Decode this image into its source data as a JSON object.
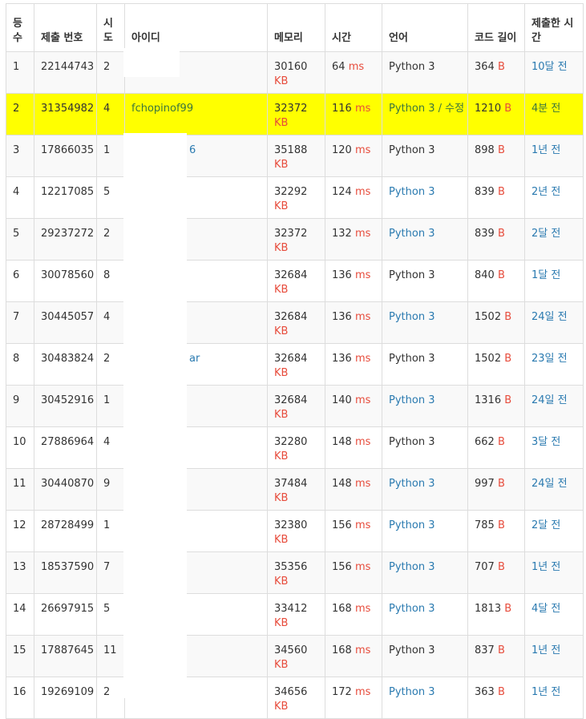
{
  "headers": {
    "rank": "등\n수",
    "submission": "제출 번호",
    "tries": "시\n도",
    "userid": "아이디",
    "memory": "메모리",
    "time": "시간",
    "language": "언어",
    "code_length": "코드 길이",
    "submitted_at": "제출한 시\n간"
  },
  "units": {
    "memory": "KB",
    "time": "ms",
    "length": "B"
  },
  "rows": [
    {
      "rank": "1",
      "sub": "22144743",
      "tries": "2",
      "user": "",
      "mem": "30160",
      "time": "64",
      "lang": "Python 3",
      "lang_link": false,
      "len": "364",
      "ago": "10달 전"
    },
    {
      "rank": "2",
      "sub": "31354982",
      "tries": "4",
      "user": "fchopinof99",
      "mem": "32372",
      "time": "116",
      "lang": "Python 3 / 수정",
      "lang_link": false,
      "len": "1210",
      "ago": "4분 전"
    },
    {
      "rank": "3",
      "sub": "17866035",
      "tries": "1",
      "user": "6",
      "mem": "35188",
      "time": "120",
      "lang": "Python 3",
      "lang_link": false,
      "len": "898",
      "ago": "1년 전"
    },
    {
      "rank": "4",
      "sub": "12217085",
      "tries": "5",
      "user": "",
      "mem": "32292",
      "time": "124",
      "lang": "Python 3",
      "lang_link": true,
      "len": "839",
      "ago": "2년 전"
    },
    {
      "rank": "5",
      "sub": "29237272",
      "tries": "2",
      "user": "",
      "mem": "32372",
      "time": "132",
      "lang": "Python 3",
      "lang_link": true,
      "len": "839",
      "ago": "2달 전"
    },
    {
      "rank": "6",
      "sub": "30078560",
      "tries": "8",
      "user": "",
      "mem": "32684",
      "time": "136",
      "lang": "Python 3",
      "lang_link": false,
      "len": "840",
      "ago": "1달 전"
    },
    {
      "rank": "7",
      "sub": "30445057",
      "tries": "4",
      "user": "",
      "mem": "32684",
      "time": "136",
      "lang": "Python 3",
      "lang_link": true,
      "len": "1502",
      "ago": "24일 전"
    },
    {
      "rank": "8",
      "sub": "30483824",
      "tries": "2",
      "user": "ar",
      "mem": "32684",
      "time": "136",
      "lang": "Python 3",
      "lang_link": false,
      "len": "1502",
      "ago": "23일 전"
    },
    {
      "rank": "9",
      "sub": "30452916",
      "tries": "1",
      "user": "",
      "mem": "32684",
      "time": "140",
      "lang": "Python 3",
      "lang_link": true,
      "len": "1316",
      "ago": "24일 전"
    },
    {
      "rank": "10",
      "sub": "27886964",
      "tries": "4",
      "user": "",
      "mem": "32280",
      "time": "148",
      "lang": "Python 3",
      "lang_link": false,
      "len": "662",
      "ago": "3달 전"
    },
    {
      "rank": "11",
      "sub": "30440870",
      "tries": "9",
      "user": "",
      "mem": "37484",
      "time": "148",
      "lang": "Python 3",
      "lang_link": true,
      "len": "997",
      "ago": "24일 전"
    },
    {
      "rank": "12",
      "sub": "28728499",
      "tries": "1",
      "user": "",
      "mem": "32380",
      "time": "156",
      "lang": "Python 3",
      "lang_link": true,
      "len": "785",
      "ago": "2달 전"
    },
    {
      "rank": "13",
      "sub": "18537590",
      "tries": "7",
      "user": "",
      "mem": "35356",
      "time": "156",
      "lang": "Python 3",
      "lang_link": true,
      "len": "707",
      "ago": "1년 전"
    },
    {
      "rank": "14",
      "sub": "26697915",
      "tries": "5",
      "user": "",
      "mem": "33412",
      "time": "168",
      "lang": "Python 3",
      "lang_link": true,
      "len": "1813",
      "ago": "4달 전"
    },
    {
      "rank": "15",
      "sub": "17887645",
      "tries": "11",
      "user": "",
      "mem": "34560",
      "time": "168",
      "lang": "Python 3",
      "lang_link": false,
      "len": "837",
      "ago": "1년 전"
    },
    {
      "rank": "16",
      "sub": "19269109",
      "tries": "2",
      "user": "",
      "mem": "34656",
      "time": "172",
      "lang": "Python 3",
      "lang_link": true,
      "len": "363",
      "ago": "1년 전"
    }
  ]
}
